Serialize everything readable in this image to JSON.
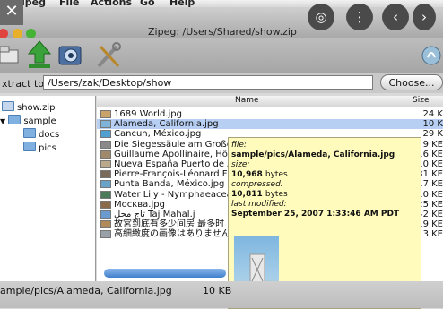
{
  "menu": [
    "Zipeg",
    "File",
    "Actions",
    "Go",
    "Help"
  ],
  "window_title": "Zipeg: /Users/Shared/show.zip",
  "overlay_icons": [
    "close-icon",
    "lens-icon",
    "more-icon",
    "back-icon",
    "forward-icon",
    "close-icon"
  ],
  "extract": {
    "label": "xtract to:",
    "value": "/Users/zak/Desktop/show",
    "choose_label": "Choose..."
  },
  "tree": {
    "root": "show.zip",
    "folder": "sample",
    "children": [
      "docs",
      "pics"
    ]
  },
  "list": {
    "col_name": "Name",
    "col_size": "Size",
    "rows": [
      {
        "name": "1689 World.jpg",
        "size": "24 K"
      },
      {
        "name": "Alameda, California.jpg",
        "size": "10 K"
      },
      {
        "name": "Cancun, México.jpg",
        "size": "29 K"
      },
      {
        "name": "Die Siegessäule am Großer",
        "size": "9 KE"
      },
      {
        "name": "Guillaume Apollinaire, Hôt",
        "size": "16 KE"
      },
      {
        "name": "Nueva España Puerto de A",
        "size": "10 KE"
      },
      {
        "name": "Pierre-François-Léonard F",
        "size": "31 KE"
      },
      {
        "name": "Punta Banda, México.jpg",
        "size": "17 KE"
      },
      {
        "name": "Water Lily - Nymphaeacea",
        "size": "10 KE"
      },
      {
        "name": "Москва.jpg",
        "size": "25 KE"
      },
      {
        "name": "تاج محل Taj Mahal.j",
        "size": "42 KE"
      },
      {
        "name": "故宮到底有多少间房 最多时",
        "size": "19 KE"
      },
      {
        "name": "高細緻度の画像はありません",
        "size": "13 KE"
      }
    ]
  },
  "tooltip": {
    "file_label": "file:",
    "file_value": "sample/pics/Alameda, California.jpg",
    "size_label": "size:",
    "size_value": "10,968",
    "size_unit": "bytes",
    "compressed_label": "compressed:",
    "compressed_value": "10,811",
    "compressed_unit": "bytes",
    "modified_label": "last modified:",
    "modified_value": "September 25, 2007 1:33:46 AM PDT"
  },
  "status": {
    "path": "ample/pics/Alameda, California.jpg",
    "size": "10 KB"
  },
  "colors": {
    "selection": "#b7cff3",
    "tooltip_bg": "#fffbbd",
    "scroll_thumb": "#3f7fcc"
  }
}
